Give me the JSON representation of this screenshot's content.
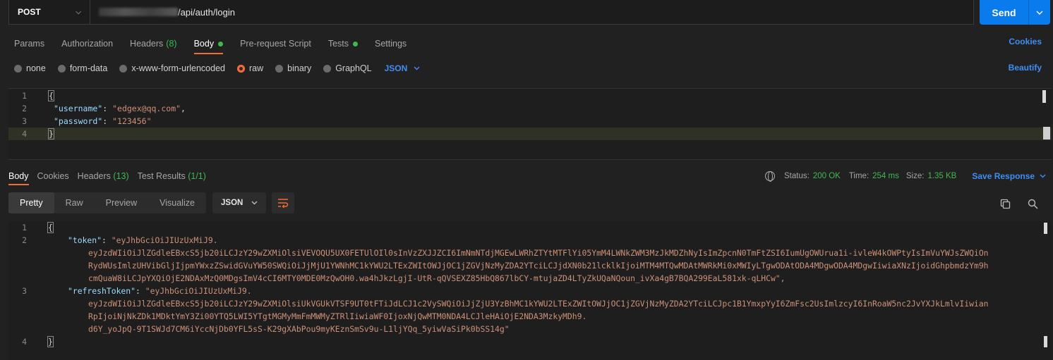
{
  "request": {
    "method": "POST",
    "url_visible": "/api/auth/login",
    "send_label": "Send"
  },
  "request_tabs": [
    {
      "label": "Params"
    },
    {
      "label": "Authorization"
    },
    {
      "label": "Headers",
      "count": "(8)"
    },
    {
      "label": "Body"
    },
    {
      "label": "Pre-request Script"
    },
    {
      "label": "Tests"
    },
    {
      "label": "Settings"
    }
  ],
  "cookies_link": "Cookies",
  "body_types": [
    "none",
    "form-data",
    "x-www-form-urlencoded",
    "raw",
    "binary",
    "GraphQL"
  ],
  "body_format": "JSON",
  "beautify_link": "Beautify",
  "request_body": {
    "line_numbers": [
      "1",
      "2",
      "3",
      "4"
    ],
    "open_brace": "{",
    "close_brace": "}",
    "username_key": "\"username\"",
    "username_value": "\"edgex@qq.com\"",
    "password_key": "\"password\"",
    "password_value": "\"123456\""
  },
  "response_tabs": [
    {
      "label": "Body"
    },
    {
      "label": "Cookies"
    },
    {
      "label": "Headers",
      "count": "(13)"
    },
    {
      "label": "Test Results",
      "count": "(1/1)"
    }
  ],
  "response_status": {
    "status_label": "Status:",
    "status_value": "200 OK",
    "time_label": "Time:",
    "time_value": "254 ms",
    "size_label": "Size:",
    "size_value": "1.35 KB",
    "save_response": "Save Response"
  },
  "view_tabs": [
    "Pretty",
    "Raw",
    "Preview",
    "Visualize"
  ],
  "view_format": "JSON",
  "response_body": {
    "line_numbers": [
      "1",
      "2",
      "3",
      "4"
    ],
    "open_brace": "{",
    "close_brace": "}",
    "token_key": "\"token\"",
    "token_lines": [
      "\"eyJhbGciOiJIUzUxMiJ9.",
      "eyJzdWIiOiJlZGdleEBxcS5jb20iLCJzY29wZXMiOlsiVEVOQU5UX0FETUlOIl0sInVzZXJJZCI6ImNmNTdjMGEwLWRhZTYtMTFlYi05YmM4LWNkZWM3MzJkMDZhNyIsImZpcnN0TmFtZSI6IumUgOWUrua1i-ivleW4kOWPtyIsImVuYWJsZWQiOn",
      "RydWUsImlzUHVibGljIjpmYWxzZSwidGVuYW50SWQiOiJjMjU1YWNhMC1kYWU2LTExZWItOWJjOC1jZGVjNzMyZDA2YTciLCJjdXN0b21lcklkIjoiMTM4MTQwMDAtMWRkMi0xMWIyLTgwODAtODA4MDgwODA4MDgwIiwiaXNzIjoidGhpbmdzYm9h",
      "cmQuaW8iLCJpYXQiOjE2NDAxMzQ0MDgsImV4cCI6MTY0MDE0MzQwOH0.wa4hJkzLgjI-UtR-qQVSEXZ85HbQ867lbCY-mtujaZD4LTyZkUQaNQoun_ivXa4gB7BQA299EaL581xk-qLHCw\","
    ],
    "refresh_key": "\"refreshToken\"",
    "refresh_lines": [
      "\"eyJhbGciOiJIUzUxMiJ9.",
      "eyJzdWIiOiJlZGdleEBxcS5jb20iLCJzY29wZXMiOlsiUkVGUkVTSF9UT0tFTiJdLCJ1c2VySWQiOiJjZjU3YzBhMC1kYWU2LTExZWItOWJjOC1jZGVjNzMyZDA2YTciLCJpc1B1YmxpYyI6ZmFsc2UsImlzcyI6InRoaW5nc2JvYXJkLmlvIiwian",
      "RpIjoiNjNkZDk1MDktYmY3Zi00YTQ5LWI5YTgtMGMyMmFmMWMyZTRlIiwiaWF0IjoxNjQwMTM0NDA4LCJleHAiOjE2NDA3MzkyMDh9.",
      "d6Y_yoJpQ-9T1SWJd7CM6iYccNjDb0YFL5sS-K29gXAbPou9myKEznSmSv9u-L1ljYQq_5yiwVaSiPk0bSS14g\""
    ]
  },
  "colors": {
    "accent_blue": "#3e8ef7",
    "send_blue": "#097bed",
    "status_green": "#3fb950",
    "active_orange": "#f26b3a"
  }
}
